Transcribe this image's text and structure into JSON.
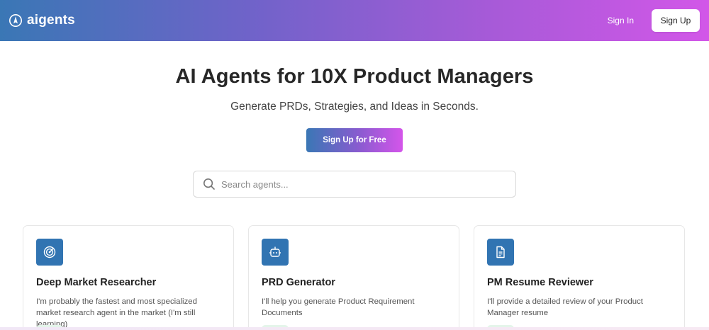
{
  "header": {
    "brand_name": "aigents",
    "brand_icon": "compass-icon",
    "signin_label": "Sign In",
    "signup_label": "Sign Up"
  },
  "hero": {
    "title": "AI Agents for 10X Product Managers",
    "subtitle": "Generate PRDs, Strategies, and Ideas in Seconds.",
    "cta_label": "Sign Up for Free"
  },
  "search": {
    "placeholder": "Search agents...",
    "icon": "search-icon"
  },
  "cards": [
    {
      "title": "Deep Market Researcher",
      "description": "I'm probably the fastest and most specialized market research agent in the market (I'm still learning)",
      "icon": "radar-icon"
    },
    {
      "title": "PRD Generator",
      "description": "I'll help you generate Product Requirement Documents",
      "icon": "robot-icon"
    },
    {
      "title": "PM Resume Reviewer",
      "description": "I'll provide a detailed review of your Product Manager resume",
      "icon": "document-icon"
    }
  ],
  "colors": {
    "gradient_start": "#3a77b5",
    "gradient_end": "#d257e8",
    "card_icon_bg": "#3174b2"
  }
}
